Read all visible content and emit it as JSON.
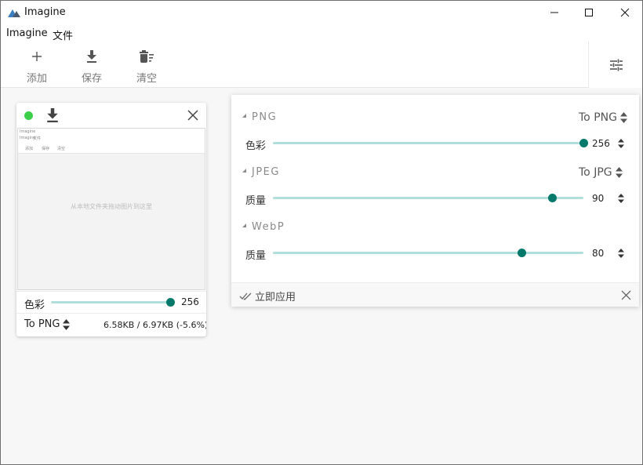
{
  "window": {
    "title": "Imagine"
  },
  "menu": {
    "items": [
      "Imagine",
      "文件"
    ]
  },
  "toolbar": {
    "add_label": "添加",
    "save_label": "保存",
    "clear_label": "清空"
  },
  "card": {
    "status_color": "#3ecf4a",
    "thumbnail": {
      "app_title": "Imagine",
      "menu_items": [
        "Imagine",
        "文件"
      ],
      "toolbar_labels": [
        "添加",
        "保存",
        "清空"
      ],
      "drop_hint": "从本地文件夹拖动图片到这里"
    },
    "color_label": "色彩",
    "color_value": "256",
    "color_level": 1.0,
    "format": "To PNG",
    "size_info": "6.58KB / 6.97KB (-5.6%)"
  },
  "panel": {
    "png": {
      "title": "PNG",
      "format": "To PNG",
      "label": "色彩",
      "value": "256",
      "level": 1.0
    },
    "jpeg": {
      "title": "JPEG",
      "format": "To JPG",
      "label": "质量",
      "value": "90",
      "level": 0.9
    },
    "webp": {
      "title": "WebP",
      "label": "质量",
      "value": "80",
      "level": 0.8
    },
    "apply_label": "立即应用"
  },
  "colors": {
    "accent": "#00796b",
    "track": "#b2dfdb"
  }
}
